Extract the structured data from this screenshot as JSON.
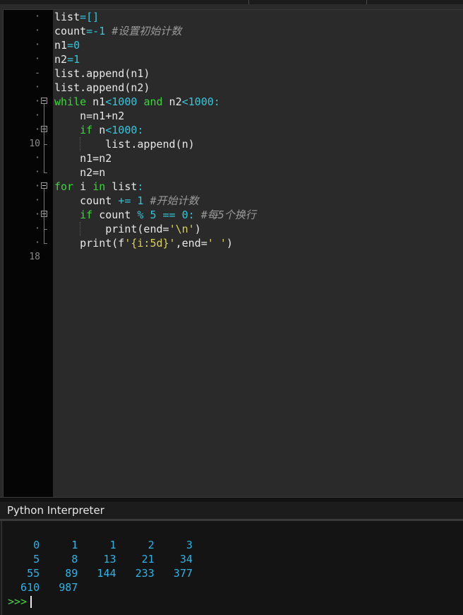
{
  "gutter": {
    "marks": [
      {
        "label": "·"
      },
      {
        "label": "·"
      },
      {
        "label": "·"
      },
      {
        "label": "·"
      },
      {
        "label": "-"
      },
      {
        "label": "·"
      },
      {
        "label": "·"
      },
      {
        "label": "·"
      },
      {
        "label": "·"
      },
      {
        "label": "10"
      },
      {
        "label": "·"
      },
      {
        "label": "·"
      },
      {
        "label": "·"
      },
      {
        "label": "·"
      },
      {
        "label": "·"
      },
      {
        "label": "·"
      },
      {
        "label": "·"
      },
      {
        "label": "18"
      }
    ]
  },
  "code_lines": [
    [
      [
        "id",
        "list"
      ],
      [
        "op",
        "=[]"
      ]
    ],
    [
      [
        "id",
        "count"
      ],
      [
        "op",
        "=-1"
      ],
      [
        "id",
        " "
      ],
      [
        "cm",
        "#设置初始计数"
      ]
    ],
    [
      [
        "id",
        "n1"
      ],
      [
        "op",
        "="
      ],
      [
        "num",
        "0"
      ]
    ],
    [
      [
        "id",
        "n2"
      ],
      [
        "op",
        "="
      ],
      [
        "num",
        "1"
      ]
    ],
    [
      [
        "id",
        "list.append(n1)"
      ]
    ],
    [
      [
        "id",
        "list.append(n2)"
      ]
    ],
    [
      [
        "kw",
        "while"
      ],
      [
        "id",
        " n1"
      ],
      [
        "op",
        "<"
      ],
      [
        "num",
        "1000"
      ],
      [
        "id",
        " "
      ],
      [
        "kw",
        "and"
      ],
      [
        "id",
        " n2"
      ],
      [
        "op",
        "<"
      ],
      [
        "num",
        "1000"
      ],
      [
        "op",
        ":"
      ]
    ],
    [
      [
        "id",
        "    n=n1+n2"
      ]
    ],
    [
      [
        "id",
        "    "
      ],
      [
        "kw",
        "if"
      ],
      [
        "id",
        " n"
      ],
      [
        "op",
        "<"
      ],
      [
        "num",
        "1000"
      ],
      [
        "op",
        ":"
      ]
    ],
    [
      [
        "id",
        "        list.append(n)"
      ]
    ],
    [
      [
        "id",
        "    n1=n2"
      ]
    ],
    [
      [
        "id",
        "    n2=n"
      ]
    ],
    [
      [
        "kw",
        "for"
      ],
      [
        "id",
        " i "
      ],
      [
        "kw",
        "in"
      ],
      [
        "id",
        " list"
      ],
      [
        "op",
        ":"
      ]
    ],
    [
      [
        "id",
        "    count "
      ],
      [
        "op",
        "+="
      ],
      [
        "id",
        " "
      ],
      [
        "num",
        "1"
      ],
      [
        "id",
        " "
      ],
      [
        "cm",
        "#开始计数"
      ]
    ],
    [
      [
        "id",
        "    "
      ],
      [
        "kw",
        "if"
      ],
      [
        "id",
        " count "
      ],
      [
        "op",
        "%"
      ],
      [
        "id",
        " "
      ],
      [
        "num",
        "5"
      ],
      [
        "id",
        " "
      ],
      [
        "op",
        "=="
      ],
      [
        "id",
        " "
      ],
      [
        "num",
        "0"
      ],
      [
        "op",
        ":"
      ],
      [
        "id",
        " "
      ],
      [
        "cm",
        "#每5个换行"
      ]
    ],
    [
      [
        "id",
        "        print(end="
      ],
      [
        "str",
        "'\\n'"
      ],
      [
        "id",
        ")"
      ]
    ],
    [
      [
        "id",
        "    print(f"
      ],
      [
        "str",
        "'{i:5d}'"
      ],
      [
        "id",
        ",end="
      ],
      [
        "str",
        "' '"
      ],
      [
        "id",
        ")"
      ]
    ],
    []
  ],
  "interpreter": {
    "title": "Python Interpreter",
    "output_lines": [
      "    0     1     1     2     3",
      "    5     8    13    21    34",
      "   55    89   144   233   377",
      "  610   987"
    ],
    "prompt": ">>>"
  }
}
